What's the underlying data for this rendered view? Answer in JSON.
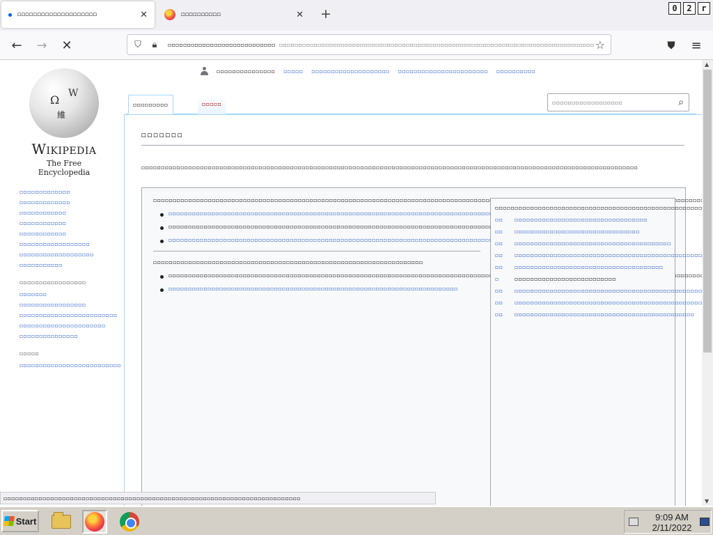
{
  "browser": {
    "tabs": [
      {
        "label": "◻◻◻◻◻◻◻◻◻◻◻◻◻◻◻◻◻◻◻◻",
        "active": true
      },
      {
        "label": "◻◻◻◻◻◻◻◻◻◻",
        "active": false
      }
    ],
    "recording_badge": [
      "0",
      "2",
      "r"
    ],
    "url": "◻◻◻◻◻◻◻◻◻◻◻◻◻◻◻◻◻◻◻◻◻◻◻◻◻◻◻◻◻◻◻◻◻◻◻◻◻◻◻◻◻◻◻◻◻◻◻◻◻◻◻◻◻◻◻◻◻◻◻◻◻◻◻◻◻◻◻◻◻◻◻◻◻◻◻◻◻◻◻◻◻◻",
    "url_domain": "◻◻◻◻◻◻◻◻◻◻◻◻◻◻◻◻◻◻◻◻◻◻◻◻◻◻◻◻",
    "icons": {
      "back": "back-arrow-icon",
      "forward": "forward-arrow-icon",
      "stop": "stop-icon",
      "shield": "shield-icon",
      "lock": "lock-icon",
      "star": "bookmark-star-icon",
      "pocket": "pocket-icon",
      "menu": "hamburger-menu-icon"
    }
  },
  "wiki": {
    "wordmark": "Wikipedia",
    "tagline": "The Free Encyclopedia",
    "personal": [
      "◻◻◻◻◻◻◻◻◻◻◻◻◻◻◻",
      "◻◻◻◻◻",
      "◻◻◻◻◻◻◻◻◻◻◻◻◻◻◻◻◻◻◻◻",
      "◻◻◻◻◻◻◻◻◻◻◻◻◻◻◻◻◻◻◻◻◻◻◻",
      "◻◻◻◻◻◻◻◻◻◻"
    ],
    "page_tabs": [
      "◻◻◻◻◻◻◻◻◻",
      "◻◻◻◻◻"
    ],
    "search_placeholder": "◻◻◻◻◻◻◻◻◻◻◻◻◻◻◻◻◻◻",
    "sidebar_nav": [
      "◻◻◻◻◻◻◻◻◻◻◻◻◻",
      "◻◻◻◻◻◻◻◻◻◻◻◻◻",
      "◻◻◻◻◻◻◻◻◻◻◻◻",
      "◻◻◻◻◻◻◻◻◻◻◻◻",
      "◻◻◻◻◻◻◻◻◻◻◻◻",
      "◻◻◻◻◻◻◻◻◻◻◻◻◻◻◻◻◻◻",
      "◻◻◻◻◻◻◻◻◻◻◻◻◻◻◻◻◻◻◻",
      "◻◻◻◻◻◻◻◻◻◻◻"
    ],
    "sidebar_contribute_head": "◻◻◻◻◻◻◻◻◻◻◻◻◻◻◻◻◻",
    "sidebar_contribute": [
      "◻◻◻◻◻◻◻",
      "◻◻◻◻◻◻◻◻◻◻◻◻◻◻◻◻◻",
      "◻◻◻◻◻◻◻◻◻◻◻◻◻◻◻◻◻◻◻◻◻◻◻◻◻",
      "◻◻◻◻◻◻◻◻◻◻◻◻◻◻◻◻◻◻◻◻◻◻",
      "◻◻◻◻◻◻◻◻◻◻◻◻◻◻◻"
    ],
    "sidebar_tools_head": "◻◻◻◻◻",
    "sidebar_tools": [
      "◻◻◻◻◻◻◻◻◻◻◻◻◻◻◻◻◻◻◻◻◻◻◻◻◻◻"
    ],
    "title": "◻◻◻◻◻◻◻",
    "subtitle": "◻◻◻◻◻◻◻◻◻◻◻◻◻◻◻◻◻◻◻◻◻◻◻◻◻◻◻◻◻◻◻◻◻◻◻◻◻◻◻◻◻◻◻◻◻◻◻◻◻◻◻◻◻◻◻◻◻◻◻◻◻◻◻◻◻◻◻◻◻◻◻◻◻◻◻◻◻◻◻◻◻◻◻◻◻◻◻◻◻◻◻◻◻◻◻◻◻◻◻◻◻◻◻◻◻◻◻◻◻◻◻◻◻◻◻◻◻◻◻◻◻◻◻◻◻◻◻",
    "intro_para": "◻◻◻◻◻◻◻◻◻◻◻◻◻◻◻◻◻◻◻◻◻◻◻◻◻◻◻◻◻◻◻◻◻◻◻◻◻◻◻◻◻◻◻◻◻◻◻◻◻◻◻◻◻◻◻◻◻◻◻◻◻◻◻◻◻◻◻◻◻◻◻◻◻◻◻◻◻◻◻◻◻◻◻◻◻◻◻◻◻◻◻◻◻◻◻◻◻◻◻◻◻◻◻◻◻◻◻◻◻◻◻◻◻◻◻◻◻◻◻◻◻◻◻◻◻◻◻◻◻◻◻◻◻◻◻◻◻◻◻◻◻◻◻◻◻◻◻◻◻◻◻◻◻◻◻◻◻◻◻◻◻◻◻◻◻◻◻◻◻◻◻◻◻◻◻◻◻◻◻◻◻◻◻◻◻◻◻◻◻◻◻◻◻◻◻◻◻◻◻◻◻◻◻◻◻◻◻◻◻◻◻◻◻◻◻◻◻◻◻◻◻◻◻◻◻◻◻◻◻◻◻◻◻◻◻◻◻◻◻◻◻◻◻◻◻◻◻◻◻◻◻◻◻◻◻◻◻◻◻◻◻◻◻◻◻◻◻",
    "intro_bullets": [
      "◻◻◻◻◻◻◻◻◻◻◻◻◻◻◻◻◻◻◻◻◻◻◻◻◻◻◻◻◻◻◻◻◻◻◻◻◻◻◻◻◻◻◻◻◻◻◻◻◻◻◻◻◻◻◻◻◻◻◻◻◻◻◻◻◻◻◻◻◻◻◻◻◻◻◻◻◻◻◻◻◻◻◻◻◻◻◻◻◻◻◻◻◻◻◻◻◻◻◻◻◻◻◻◻◻◻◻◻◻",
      "◻◻◻◻◻◻◻◻◻◻◻◻◻◻◻◻◻◻◻◻◻◻◻◻◻◻◻◻◻◻◻◻◻◻◻◻◻◻◻◻◻◻◻◻◻◻◻◻◻◻◻◻◻◻◻◻◻◻◻◻◻◻◻◻◻◻◻◻◻◻◻◻◻◻◻◻◻◻◻◻◻◻◻◻◻◻◻◻",
      "◻◻◻◻◻◻◻◻◻◻◻◻◻◻◻◻◻◻◻◻◻◻◻◻◻◻◻◻◻◻◻◻◻◻◻◻◻◻◻◻◻◻◻◻◻◻◻◻◻◻◻◻◻◻◻◻◻◻◻◻◻◻◻◻◻◻◻◻◻◻◻◻◻◻◻◻◻◻◻◻◻◻◻◻◻◻◻◻◻◻"
    ],
    "second_para": "◻◻◻◻◻◻◻◻◻◻◻◻◻◻◻◻◻◻◻◻◻◻◻◻◻◻◻◻◻◻◻◻◻◻◻◻◻◻◻◻◻◻◻◻◻◻◻◻◻◻◻◻◻◻◻◻◻◻◻◻◻◻◻◻◻◻◻◻◻",
    "second_bullets": [
      "◻◻◻◻◻◻◻◻◻◻◻◻◻◻◻◻◻◻◻◻◻◻◻◻◻◻◻◻◻◻◻◻◻◻◻◻◻◻◻◻◻◻◻◻◻◻◻◻◻◻◻◻◻◻◻◻◻◻◻◻◻◻◻◻◻◻◻◻◻◻◻◻◻◻◻◻◻◻◻◻◻◻◻◻◻◻◻◻◻◻◻◻◻◻◻◻◻◻◻◻◻◻◻◻◻◻◻◻◻◻◻◻◻◻◻◻◻◻◻◻◻◻◻◻◻◻◻◻◻◻◻◻◻◻◻◻◻◻◻◻◻◻◻◻◻◻◻◻◻◻◻◻◻◻◻◻◻◻◻◻◻◻◻◻◻◻◻◻◻◻◻◻◻◻◻◻◻◻◻◻◻◻◻◻◻◻◻◻◻◻◻◻◻◻◻◻◻◻◻◻◻◻◻◻◻◻◻◻◻◻◻◻◻◻◻◻◻◻◻◻◻◻◻◻◻◻◻◻◻◻◻◻◻◻◻◻◻◻◻◻◻◻◻◻◻◻◻◻◻◻◻◻◻◻◻◻◻◻",
      "◻◻◻◻◻◻◻◻◻◻◻◻◻◻◻◻◻◻◻◻◻◻◻◻◻◻◻◻◻◻◻◻◻◻◻◻◻◻◻◻◻◻◻◻◻◻◻◻◻◻◻◻◻◻◻◻◻◻◻◻◻◻◻◻◻◻◻◻◻◻◻◻◻◻"
    ],
    "right_intro": "◻◻◻◻◻◻◻◻◻◻◻◻◻◻◻◻◻◻◻◻◻◻◻◻◻◻◻◻◻◻◻◻◻◻◻◻◻◻◻◻◻◻◻◻◻◻◻◻◻◻◻◻◻◻◻◻◻◻◻◻◻◻◻◻◻◻◻◻◻◻◻◻◻◻◻◻◻◻◻◻◻◻◻◻◻◻◻◻◻◻◻◻◻◻◻◻◻◻◻◻◻",
    "right_lines": [
      {
        "k": "◻◻",
        "v": "◻◻◻◻◻◻◻◻◻◻◻◻◻◻◻◻◻◻◻◻◻◻◻◻◻◻◻◻◻◻◻◻◻◻"
      },
      {
        "k": "◻◻",
        "v": "◻◻◻◻◻◻◻◻◻◻◻◻◻◻◻◻◻◻◻◻◻◻◻◻◻◻◻◻◻◻◻◻"
      },
      {
        "k": "◻◻",
        "v": "◻◻◻◻◻◻◻◻◻◻◻◻◻◻◻◻◻◻◻◻◻◻◻◻◻◻◻◻◻◻◻◻◻◻◻◻◻◻◻◻"
      },
      {
        "k": "◻◻",
        "v": "◻◻◻◻◻◻◻◻◻◻◻◻◻◻◻◻◻◻◻◻◻◻◻◻◻◻◻◻◻◻◻◻◻◻◻◻◻◻◻◻◻◻◻◻◻◻◻◻◻◻◻"
      },
      {
        "k": "◻◻",
        "v": "◻◻◻◻◻◻◻◻◻◻◻◻◻◻◻◻◻◻◻◻◻◻◻◻◻◻◻◻◻◻◻◻◻◻◻◻◻◻"
      },
      {
        "k": "◻",
        "v": "◻◻◻◻◻◻◻◻◻◻◻◻◻◻◻◻◻◻◻◻◻◻◻◻◻◻"
      },
      {
        "k": "◻◻",
        "v": "◻◻◻◻◻◻◻◻◻◻◻◻◻◻◻◻◻◻◻◻◻◻◻◻◻◻◻◻◻◻◻◻◻◻◻◻◻◻◻◻◻◻◻◻◻◻◻◻◻◻◻◻◻◻◻"
      },
      {
        "k": "◻◻",
        "v": "◻◻◻◻◻◻◻◻◻◻◻◻◻◻◻◻◻◻◻◻◻◻◻◻◻◻◻◻◻◻◻◻◻◻◻◻◻◻◻◻◻◻◻◻◻◻◻◻◻◻"
      },
      {
        "k": "◻◻",
        "v": "◻◻◻◻◻◻◻◻◻◻◻◻◻◻◻◻◻◻◻◻◻◻◻◻◻◻◻◻◻◻◻◻◻◻◻◻◻◻◻◻◻◻◻◻◻◻"
      }
    ],
    "status": "◻◻◻◻◻◻◻◻◻◻◻◻◻◻◻◻◻◻◻◻◻◻◻◻◻◻◻◻◻◻◻◻◻◻◻◻◻◻◻◻◻◻◻◻◻◻◻◻◻◻◻◻◻◻◻◻◻◻◻◻◻◻◻◻◻◻◻◻◻◻◻◻◻◻◻◻"
  },
  "taskbar": {
    "start_label": "Start",
    "time": "9:09 AM",
    "date": "2/11/2022",
    "apps": [
      "folder-icon",
      "firefox-icon",
      "chrome-icon"
    ]
  }
}
